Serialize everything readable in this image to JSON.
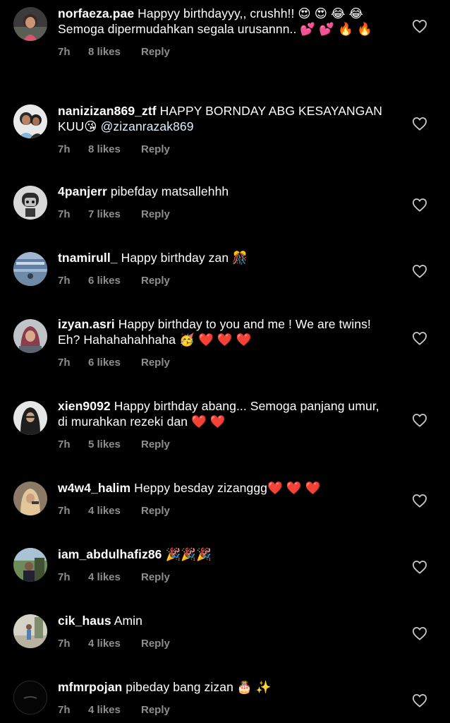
{
  "comments": [
    {
      "username": "norfaeza.pae",
      "text": "Happyy birthdayyy,, crushh!! 😍 😍 😂 😂 Semoga dipermudahkan segala urusannn.. 💕 💕 🔥 🔥",
      "time": "7h",
      "likes": "8 likes",
      "reply": "Reply"
    },
    {
      "username": "nanizizan869_ztf",
      "text": "HAPPY BORNDAY ABG KESAYANGAN KUU😘 ",
      "mention": "@zizanrazak869",
      "time": "7h",
      "likes": "8 likes",
      "reply": "Reply"
    },
    {
      "username": "4panjerr",
      "text": "pibefday matsallehhh",
      "time": "7h",
      "likes": "7 likes",
      "reply": "Reply"
    },
    {
      "username": "tnamirull_",
      "text": "Happy birthday zan 🎊",
      "time": "7h",
      "likes": "6 likes",
      "reply": "Reply"
    },
    {
      "username": "izyan.asri",
      "text": "Happy birthday to you and me ! We are twins! Eh? Hahahahahhaha 🥳 ❤️ ❤️ ❤️",
      "time": "7h",
      "likes": "6 likes",
      "reply": "Reply"
    },
    {
      "username": "xien9092",
      "text": "Happy birthday abang... Semoga panjang umur, di murahkan rezeki dan ❤️ ❤️",
      "time": "7h",
      "likes": "5 likes",
      "reply": "Reply"
    },
    {
      "username": "w4w4_halim",
      "text": "Heppy besday zizanggg❤️ ❤️ ❤️",
      "time": "7h",
      "likes": "4 likes",
      "reply": "Reply"
    },
    {
      "username": "iam_abdulhafiz86",
      "text": "🎉🎉🎉",
      "time": "7h",
      "likes": "4 likes",
      "reply": "Reply"
    },
    {
      "username": "cik_haus",
      "text": "Amin",
      "time": "7h",
      "likes": "4 likes",
      "reply": "Reply"
    },
    {
      "username": "mfmrpojan",
      "text": "pibeday bang zizan 🎂 ✨",
      "time": "7h",
      "likes": "4 likes",
      "reply": "Reply"
    }
  ],
  "icons": {
    "like": "heart-outline-icon"
  },
  "colors": {
    "background": "#000000",
    "text": "#ffffff",
    "meta": "#8e8e8e"
  }
}
